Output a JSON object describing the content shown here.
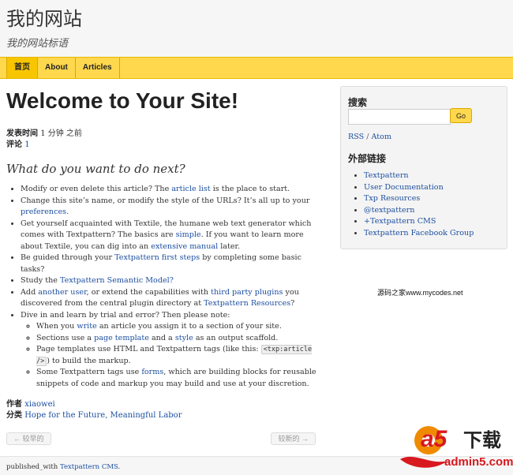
{
  "header": {
    "site_name": "我的网站",
    "slogan": "我的网站标语"
  },
  "nav": {
    "items": [
      {
        "label": "首页"
      },
      {
        "label": "About"
      },
      {
        "label": "Articles"
      }
    ]
  },
  "article": {
    "title": "Welcome to Your Site!",
    "meta": {
      "posted_label": "发表时间",
      "posted_value": "1 分钟 之前",
      "comments_label": "评论",
      "comments_value": "1"
    },
    "subheading": "What do you want to do next?",
    "list": {
      "i1_a": "Modify or even delete this article? The ",
      "i1_link": "article list",
      "i1_b": " is the place to start.",
      "i2_a": "Change this site’s name, or modify the style of the URLs? It’s all up to your ",
      "i2_link": "preferences",
      "i2_b": ".",
      "i3_a": "Get yourself acquainted with Textile, the humane web text generator which comes with Textpattern? The basics are ",
      "i3_link1": "simple",
      "i3_b": ". If you want to learn more about Textile, you can dig into an ",
      "i3_link2": "extensive manual",
      "i3_c": " later.",
      "i4_a": "Be guided through your ",
      "i4_link": "Textpattern first steps",
      "i4_b": " by completing some basic tasks?",
      "i5_a": "Study the ",
      "i5_link": "Textpattern Semantic Model?",
      "i6_a": "Add ",
      "i6_link1": "another user",
      "i6_b": ", or extend the capabilities with ",
      "i6_link2": "third party plugins",
      "i6_c": " you discovered from the central plugin directory at ",
      "i6_link3": "Textpattern Resources",
      "i6_d": "?",
      "i7_a": "Dive in and learn by trial and error? Then please note:",
      "s1_a": "When you ",
      "s1_link": "write",
      "s1_b": " an article you assign it to a section of your site.",
      "s2_a": "Sections use a ",
      "s2_link1": "page template",
      "s2_b": " and a ",
      "s2_link2": "style",
      "s2_c": " as an output scaffold.",
      "s3_a": "Page templates use HTML and Textpattern tags (like this: ",
      "s3_code": "<txp:article />",
      "s3_b": ") to build the markup.",
      "s4_a": "Some Textpattern tags use ",
      "s4_link": "forms",
      "s4_b": ", which are building blocks for reusable snippets of code and markup you may build and use at your discretion."
    },
    "author_label": "作者",
    "author_value": "xiaowei",
    "category_label": "分类",
    "category_value": "Hope for the Future, Meaningful Labor"
  },
  "pager": {
    "prev_label": "← 较早的",
    "next_label": "较新的 →"
  },
  "sidebar": {
    "search_heading": "搜索",
    "search_value": "",
    "go_label": "Go",
    "rss_label": "RSS",
    "feed_sep": " / ",
    "atom_label": "Atom",
    "links_heading": "外部链接",
    "links": [
      {
        "label": "Textpattern"
      },
      {
        "label": "User Documentation"
      },
      {
        "label": "Txp Resources"
      },
      {
        "label": "@textpattern"
      },
      {
        "label": "+Textpattern CMS"
      },
      {
        "label": "Textpattern Facebook Group"
      }
    ]
  },
  "watermark": {
    "text": "源码之家www.mycodes.net"
  },
  "footer": {
    "prefix": "published_with ",
    "link": "Textpattern CMS",
    "suffix": "."
  },
  "logo": {
    "brand": "a5",
    "tagline": "下载",
    "domain": "admin5.com",
    "colors": {
      "orange": "#f08a00",
      "red": "#d8191f",
      "dark": "#222222"
    }
  }
}
